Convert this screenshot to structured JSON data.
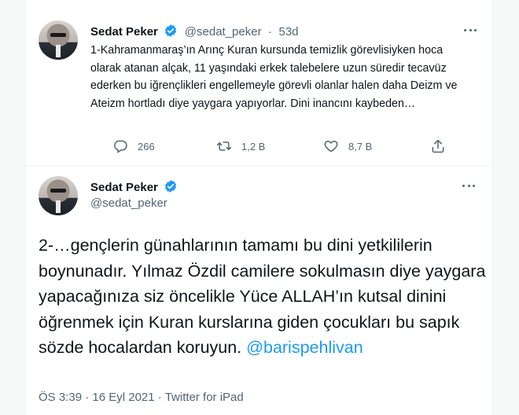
{
  "tweet1": {
    "name": "Sedat Peker",
    "handle": "@sedat_peker",
    "separator": "·",
    "time": "53d",
    "text": "1-Kahramanmaraş’ın Arınç Kuran kursunda temizlik görevlisiyken hoca olarak atanan alçak, 11 yaşındaki erkek talebelere uzun süredir tecavüz ederken bu iğrençlikleri engellemeyle görevli olanlar halen daha Deizm ve Ateizm hortladı diye yaygara yapıyorlar. Dini inancını kaybeden…",
    "replies": "266",
    "retweets": "1,2 B",
    "likes": "8,7 B"
  },
  "tweet2": {
    "name": "Sedat Peker",
    "handle": "@sedat_peker",
    "text": "2-…gençlerin günahlarının tamamı bu dini yetkililerin boynunadır. Yılmaz Özdil camilere sokulmasın diye yaygara yapacağınıza siz öncelikle Yüce ALLAH’ın kutsal dinini öğrenmek için Kuran kurslarına giden çocukları bu sapık sözde hocalardan koruyun.",
    "mention": "@barispehlivan",
    "time": "ÖS 3:39",
    "date": "16 Eyl 2021",
    "source": "Twitter for iPad",
    "meta_sep": "·"
  },
  "icons": [
    "verified-badge-icon",
    "more-icon",
    "reply-icon",
    "retweet-icon",
    "like-icon",
    "share-icon"
  ],
  "colors": {
    "accent": "#1d9bf0",
    "muted": "#536471",
    "text": "#0f1419"
  }
}
